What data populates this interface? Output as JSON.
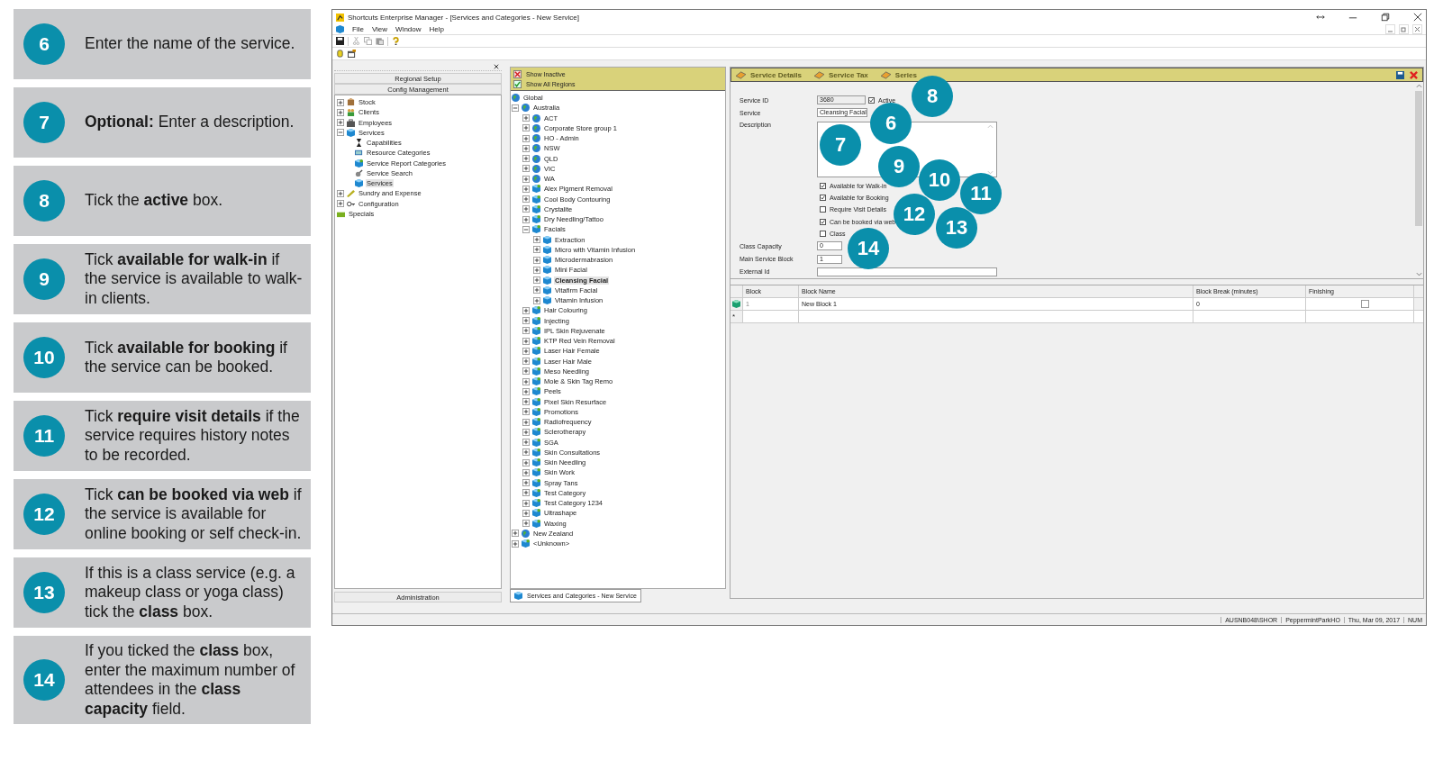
{
  "steps": [
    {
      "number": "6",
      "text": "Enter the name of the service."
    },
    {
      "number": "7",
      "text": "**Optional:** Enter a description."
    },
    {
      "number": "8",
      "text": "Tick the **active** box."
    },
    {
      "number": "9",
      "text": "Tick **available for walk-in** if the service is available to walk-in clients."
    },
    {
      "number": "10",
      "text": "Tick **available for booking** if the service can be booked."
    },
    {
      "number": "11",
      "text": "Tick **require visit details** if the service requires history notes to be recorded."
    },
    {
      "number": "12",
      "text": "Tick **can be booked via web** if the service is available for online booking or self check-in."
    },
    {
      "number": "13",
      "text": "If this is a class service (e.g. a makeup class or yoga class) tick the **class** box."
    },
    {
      "number": "14",
      "text": "If you ticked the **class** box, enter the maximum number of attendees in the **class capacity** field."
    }
  ],
  "callouts": [
    "8",
    "6",
    "7",
    "9",
    "10",
    "11",
    "12",
    "13",
    "14"
  ],
  "window": {
    "title": "Shortcuts Enterprise Manager - [Services and Categories - New Service]"
  },
  "menu": [
    "File",
    "View",
    "Window",
    "Help"
  ],
  "left_panel": {
    "buttons": [
      "Regional Setup",
      "Config Management"
    ],
    "tree": [
      {
        "label": "Stock",
        "kind": "box",
        "expanded": false,
        "selected": false
      },
      {
        "label": "Clients",
        "kind": "people",
        "expanded": false,
        "selected": false
      },
      {
        "label": "Employees",
        "kind": "case",
        "expanded": false,
        "selected": false
      },
      {
        "label": "Services",
        "kind": "cube",
        "expanded": true,
        "selected": false,
        "children": [
          {
            "label": "Capabilities",
            "kind": "hourglass",
            "selected": false
          },
          {
            "label": "Resource Categories",
            "kind": "cap",
            "selected": false
          },
          {
            "label": "Service Report Categories",
            "kind": "catcube",
            "selected": false
          },
          {
            "label": "Service Search",
            "kind": "search",
            "selected": false
          },
          {
            "label": "Services",
            "kind": "cube",
            "selected": true
          }
        ]
      },
      {
        "label": "Sundry and Expense",
        "kind": "stick",
        "expanded": false,
        "selected": false
      },
      {
        "label": "Configuration",
        "kind": "key",
        "expanded": false,
        "selected": false
      },
      {
        "label": "Specials",
        "kind": "ticket",
        "selected": false
      }
    ],
    "bottom_button": "Administration"
  },
  "middle_panel": {
    "filters": [
      {
        "label": "Show Inactive",
        "on": false
      },
      {
        "label": "Show All Regions",
        "on": true
      }
    ],
    "tree": [
      {
        "label": "Global",
        "kind": "globe",
        "selected": false
      },
      {
        "label": "Australia",
        "kind": "globe",
        "expanded": true,
        "selected": false,
        "children": [
          {
            "label": "ACT",
            "kind": "globe",
            "expanded": false,
            "selected": false
          },
          {
            "label": "Corporate Store group 1",
            "kind": "globe",
            "expanded": false,
            "selected": false
          },
          {
            "label": "HO - Admin",
            "kind": "globe",
            "expanded": false,
            "selected": false
          },
          {
            "label": "NSW",
            "kind": "globe",
            "expanded": false,
            "selected": false
          },
          {
            "label": "QLD",
            "kind": "globe",
            "expanded": false,
            "selected": false
          },
          {
            "label": "VIC",
            "kind": "globe",
            "expanded": false,
            "selected": false
          },
          {
            "label": "WA",
            "kind": "globe",
            "expanded": false,
            "selected": false
          },
          {
            "label": "Alex Pigment Removal",
            "kind": "catcube",
            "expanded": false,
            "selected": false
          },
          {
            "label": "Cool Body Contouring",
            "kind": "catcube",
            "expanded": false,
            "selected": false
          },
          {
            "label": "Crystalite",
            "kind": "catcube",
            "expanded": false,
            "selected": false
          },
          {
            "label": "Dry Needling/Tattoo",
            "kind": "catcube",
            "expanded": false,
            "selected": false
          },
          {
            "label": "Facials",
            "kind": "catcube",
            "expanded": true,
            "selected": false,
            "children": [
              {
                "label": "Extraction",
                "kind": "cube",
                "expanded": false,
                "selected": false
              },
              {
                "label": "Micro with Vitamin Infusion",
                "kind": "cube",
                "expanded": false,
                "selected": false
              },
              {
                "label": "Microdermabrasion",
                "kind": "cube",
                "expanded": false,
                "selected": false
              },
              {
                "label": "Mini Facial",
                "kind": "cube",
                "expanded": false,
                "selected": false
              },
              {
                "label": "Cleansing Facial",
                "kind": "cube",
                "expanded": false,
                "selected": true
              },
              {
                "label": "Vitafirm Facial",
                "kind": "cube",
                "expanded": false,
                "selected": false
              },
              {
                "label": "Vitamin Infusion",
                "kind": "cube",
                "expanded": false,
                "selected": false
              }
            ]
          },
          {
            "label": "Hair Colouring",
            "kind": "catcube",
            "expanded": false,
            "selected": false
          },
          {
            "label": "Injecting",
            "kind": "catcube",
            "expanded": false,
            "selected": false
          },
          {
            "label": "IPL Skin Rejuvenate",
            "kind": "catcube",
            "expanded": false,
            "selected": false
          },
          {
            "label": "KTP Red Vein Removal",
            "kind": "catcube",
            "expanded": false,
            "selected": false
          },
          {
            "label": "Laser Hair Female",
            "kind": "catcube",
            "expanded": false,
            "selected": false
          },
          {
            "label": "Laser Hair Male",
            "kind": "catcube",
            "expanded": false,
            "selected": false
          },
          {
            "label": "Meso Needling",
            "kind": "catcube",
            "expanded": false,
            "selected": false
          },
          {
            "label": "Mole & Skin Tag Remo",
            "kind": "catcube",
            "expanded": false,
            "selected": false
          },
          {
            "label": "Peels",
            "kind": "catcube",
            "expanded": false,
            "selected": false
          },
          {
            "label": "Pixel Skin Resurface",
            "kind": "catcube",
            "expanded": false,
            "selected": false
          },
          {
            "label": "Promotions",
            "kind": "catcube",
            "expanded": false,
            "selected": false
          },
          {
            "label": "Radiofrequency",
            "kind": "catcube",
            "expanded": false,
            "selected": false
          },
          {
            "label": "Sclerotherapy",
            "kind": "catcube",
            "expanded": false,
            "selected": false
          },
          {
            "label": "SGA",
            "kind": "catcube",
            "expanded": false,
            "selected": false
          },
          {
            "label": "Skin Consultations",
            "kind": "catcube",
            "expanded": false,
            "selected": false
          },
          {
            "label": "Skin Needling",
            "kind": "catcube",
            "expanded": false,
            "selected": false
          },
          {
            "label": "Skin Work",
            "kind": "catcube",
            "expanded": false,
            "selected": false
          },
          {
            "label": "Spray Tans",
            "kind": "catcube",
            "expanded": false,
            "selected": false
          },
          {
            "label": "Test Category",
            "kind": "catcube",
            "expanded": false,
            "selected": false
          },
          {
            "label": "Test Category 1234",
            "kind": "catcube",
            "expanded": false,
            "selected": false
          },
          {
            "label": "Ultrashape",
            "kind": "catcube",
            "expanded": false,
            "selected": false
          },
          {
            "label": "Waxing",
            "kind": "catcube",
            "expanded": false,
            "selected": false
          }
        ]
      },
      {
        "label": "New Zealand",
        "kind": "globe",
        "expanded": false,
        "selected": false
      },
      {
        "label": "<Unknown>",
        "kind": "catcube",
        "expanded": false,
        "selected": false
      }
    ]
  },
  "document_tab": {
    "label": "Services and Categories - New Service"
  },
  "detail_tabs": [
    "Service Details",
    "Service Tax",
    "Series"
  ],
  "form": {
    "service_id": {
      "label": "Service ID",
      "value": "3680"
    },
    "active": {
      "label": "Active",
      "checked": true
    },
    "service": {
      "label": "Service",
      "value": "Cleansing Facial"
    },
    "description": {
      "label": "Description"
    },
    "options": [
      {
        "label": "Available for Walk-in",
        "checked": true
      },
      {
        "label": "Available for Booking",
        "checked": true
      },
      {
        "label": "Require Visit Details",
        "checked": false
      },
      {
        "label": "Can be booked via web",
        "checked": true
      },
      {
        "label": "Class",
        "checked": false
      }
    ],
    "class_capacity": {
      "label": "Class Capacity",
      "value": "0"
    },
    "main_service_block": {
      "label": "Main Service Block",
      "value": "1"
    },
    "external_id": {
      "label": "External Id"
    }
  },
  "grid": {
    "columns": [
      "Block",
      "Block Name",
      "Block Break (minutes)",
      "Finishing"
    ],
    "rows": [
      {
        "block": "1",
        "block_name": "New Block 1",
        "block_break": "0",
        "finishing": false
      }
    ],
    "new_row_marker": "*"
  },
  "status_bar": [
    "AUSNB048\\SHOR",
    "PeppermintParkHO",
    "Thu, Mar 09, 2017",
    "NUM"
  ]
}
